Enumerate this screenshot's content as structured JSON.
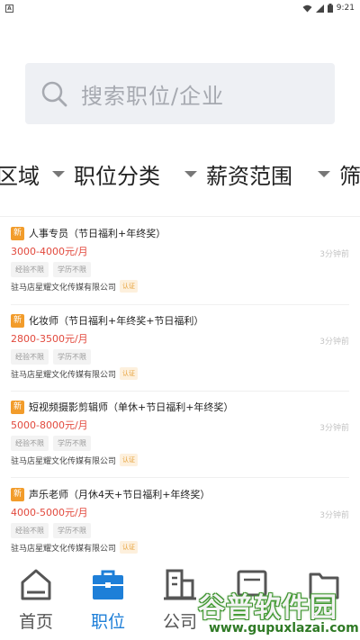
{
  "status_bar": {
    "notification_icon": "A",
    "time": "9:21",
    "icons": [
      "wifi-icon",
      "signal-icon",
      "battery-icon"
    ]
  },
  "search": {
    "placeholder": "搜索职位/企业",
    "icon": "search-icon"
  },
  "filters": [
    {
      "label": "区域"
    },
    {
      "label": "职位分类"
    },
    {
      "label": "薪资范围"
    },
    {
      "label": "筛"
    }
  ],
  "jobs": [
    {
      "badge": "新",
      "title": "人事专员（节日福利+年终奖）",
      "salary": "3000-4000元/月",
      "time": "3分钟前",
      "tags": [
        "经验不限",
        "学历不限"
      ],
      "company": "驻马店星耀文化传媒有限公司",
      "verified": "认证"
    },
    {
      "badge": "新",
      "title": "化妆师（节日福利+年终奖+节日福利）",
      "salary": "2800-3500元/月",
      "time": "3分钟前",
      "tags": [
        "经验不限",
        "学历不限"
      ],
      "company": "驻马店星耀文化传媒有限公司",
      "verified": "认证"
    },
    {
      "badge": "新",
      "title": "短视频摄影剪辑师（单休+节日福利+年终奖）",
      "salary": "5000-8000元/月",
      "time": "3分钟前",
      "tags": [
        "经验不限",
        "学历不限"
      ],
      "company": "驻马店星耀文化传媒有限公司",
      "verified": "认证"
    },
    {
      "badge": "新",
      "title": "声乐老师（月休4天+节日福利+年终奖）",
      "salary": "4000-5000元/月",
      "time": "3分钟前",
      "tags": [
        "经验不限",
        "学历不限"
      ],
      "company": "驻马店星耀文化传媒有限公司",
      "verified": "认证"
    }
  ],
  "tab_bar": {
    "tabs": [
      {
        "label": "首页",
        "icon": "home-icon",
        "active": false
      },
      {
        "label": "职位",
        "icon": "briefcase-icon",
        "active": true
      },
      {
        "label": "公司",
        "icon": "building-icon",
        "active": false
      },
      {
        "label": "",
        "icon": "message-icon",
        "active": false
      },
      {
        "label": "",
        "icon": "profile-folder-icon",
        "active": false
      }
    ]
  },
  "watermark": {
    "text": "谷普软件园",
    "url": "www.gupuxlazai.com"
  },
  "colors": {
    "accent": "#1e7fd8",
    "salary": "#e2493d",
    "new_badge": "#f29c2b",
    "verified_bg": "#fdf0dd",
    "search_bg": "#eef0f4"
  }
}
